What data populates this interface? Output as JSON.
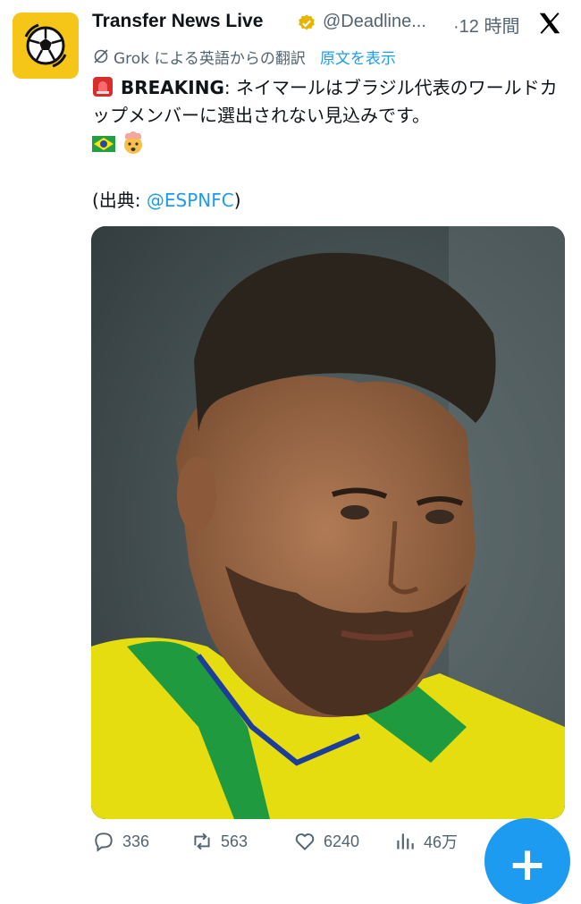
{
  "tweet": {
    "author_name": "Transfer News Live",
    "handle": "@Deadline...",
    "separator": "·",
    "time": "12 時間",
    "translation_note": "Grok による英語からの翻訳",
    "show_original": "原文を表示",
    "breaking_label": "BREAKING",
    "colon": ":",
    "text": " ネイマールはブラジル代表のワールドカップメンバーに選出されない見込みです。",
    "source_prefix": "(出典: ",
    "source_mention": "@ESPNFC",
    "source_suffix": ")"
  },
  "actions": {
    "replies": "336",
    "reposts": "563",
    "likes": "6240",
    "views": "46万"
  },
  "fab": {
    "label": "+"
  },
  "colors": {
    "accent": "#1d9bf0",
    "avatar_bg": "#f5c518",
    "muted": "#536471"
  },
  "icons": [
    "verified-badge-icon",
    "x-logo-icon",
    "grok-icon",
    "siren-icon",
    "brazil-flag-icon",
    "exploding-head-icon",
    "reply-icon",
    "repost-icon",
    "like-icon",
    "views-icon",
    "plus-icon"
  ]
}
